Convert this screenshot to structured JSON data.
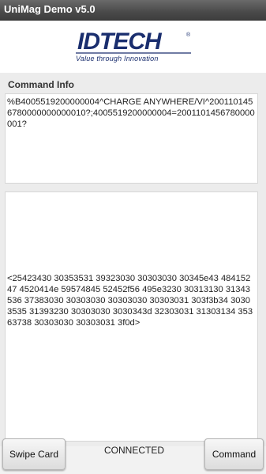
{
  "app": {
    "title": "UniMag Demo v5.0"
  },
  "logo": {
    "brand": "IDTECH",
    "registered": "®",
    "tagline": "Value through Innovation"
  },
  "command_info": {
    "label": "Command Info",
    "card_data": "%B4005519200000004^CHARGE ANYWHERE/VI^2001101456780000000000010?;4005519200000004=2001101456780000001?",
    "hex_data": "<25423430 30353531 39323030 30303030 30345e43 48415247 4520414e 59574845 52452f56 495e3230 30313130 31343536 37383030 30303030 30303030 30303031 303f3b34 30303535 31393230 30303030 3030343d 32303031 31303134 35363738 30303030 30303031 3f0d>"
  },
  "bottom": {
    "swipe_button": "Swipe Card",
    "status": "CONNECTED",
    "command_button": "Command"
  },
  "colors": {
    "brand_blue": "#1a2e6e",
    "accent_line": "#1a2e6e"
  }
}
